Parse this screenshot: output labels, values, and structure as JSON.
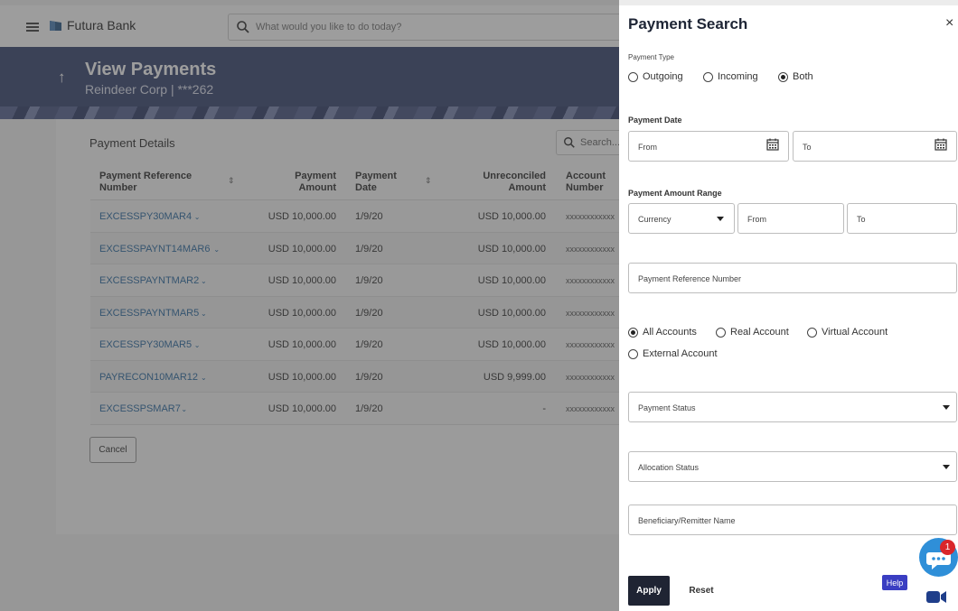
{
  "topbar": {
    "bank_name": "Futura Bank",
    "search_placeholder": "What would you like to do today?"
  },
  "header": {
    "title": "View Payments",
    "subtitle": "Reindeer Corp | ***262"
  },
  "card": {
    "title": "Payment Details",
    "search_placeholder": "Search..."
  },
  "table": {
    "columns": {
      "ref": "Payment Reference Number",
      "amount": "Payment Amount",
      "date": "Payment Date",
      "unrec": "Unreconciled Amount",
      "account": "Account Number"
    },
    "rows": [
      {
        "ref": "EXCESSPY30MAR4",
        "amount": "USD 10,000.00",
        "date": "1/9/20",
        "unrec": "USD 10,000.00",
        "account": "xxxxxxxxxxxx"
      },
      {
        "ref": "EXCESSPAYNT14MAR6",
        "amount": "USD 10,000.00",
        "date": "1/9/20",
        "unrec": "USD 10,000.00",
        "account": "xxxxxxxxxxxx"
      },
      {
        "ref": "EXCESSPAYNTMAR2",
        "amount": "USD 10,000.00",
        "date": "1/9/20",
        "unrec": "USD 10,000.00",
        "account": "xxxxxxxxxxxx"
      },
      {
        "ref": "EXCESSPAYNTMAR5",
        "amount": "USD 10,000.00",
        "date": "1/9/20",
        "unrec": "USD 10,000.00",
        "account": "xxxxxxxxxxxx"
      },
      {
        "ref": "EXCESSPY30MAR5",
        "amount": "USD 10,000.00",
        "date": "1/9/20",
        "unrec": "USD 10,000.00",
        "account": "xxxxxxxxxxxx"
      },
      {
        "ref": "PAYRECON10MAR12",
        "amount": "USD 10,000.00",
        "date": "1/9/20",
        "unrec": "USD 9,999.00",
        "account": "xxxxxxxxxxxx"
      },
      {
        "ref": "EXCESSPSMAR7",
        "amount": "USD 10,000.00",
        "date": "1/9/20",
        "unrec": "-",
        "account": "xxxxxxxxxxxx"
      }
    ]
  },
  "cancel_label": "Cancel",
  "panel": {
    "title": "Payment Search",
    "close_glyph": "×",
    "payment_type_label": "Payment Type",
    "payment_type_options": [
      "Outgoing",
      "Incoming",
      "Both"
    ],
    "payment_type_selected": "Both",
    "payment_date_label": "Payment Date",
    "date_from_placeholder": "From",
    "date_to_placeholder": "To",
    "amount_range_label": "Payment Amount Range",
    "currency_placeholder": "Currency",
    "amount_from_placeholder": "From",
    "amount_to_placeholder": "To",
    "reference_placeholder": "Payment Reference Number",
    "account_options": [
      "All Accounts",
      "Real Account",
      "Virtual Account",
      "External Account"
    ],
    "account_selected": "All Accounts",
    "payment_status_placeholder": "Payment Status",
    "allocation_status_placeholder": "Allocation Status",
    "beneficiary_placeholder": "Beneficiary/Remitter Name",
    "apply_label": "Apply",
    "reset_label": "Reset"
  },
  "help_label": "Help",
  "chat_badge_count": "1",
  "icons": {
    "menu": "hamburger-icon",
    "search": "search-icon",
    "calendar": "calendar-icon",
    "dropdown": "caret-down-icon",
    "chat": "chat-icon",
    "video": "video-icon"
  },
  "colors": {
    "banner": "#3b4873",
    "link": "#2f6da3",
    "apply_button": "#1f2433",
    "help_button": "#3a3ec2",
    "chat_bubble": "#2f8fd8",
    "badge": "#d9262b"
  }
}
